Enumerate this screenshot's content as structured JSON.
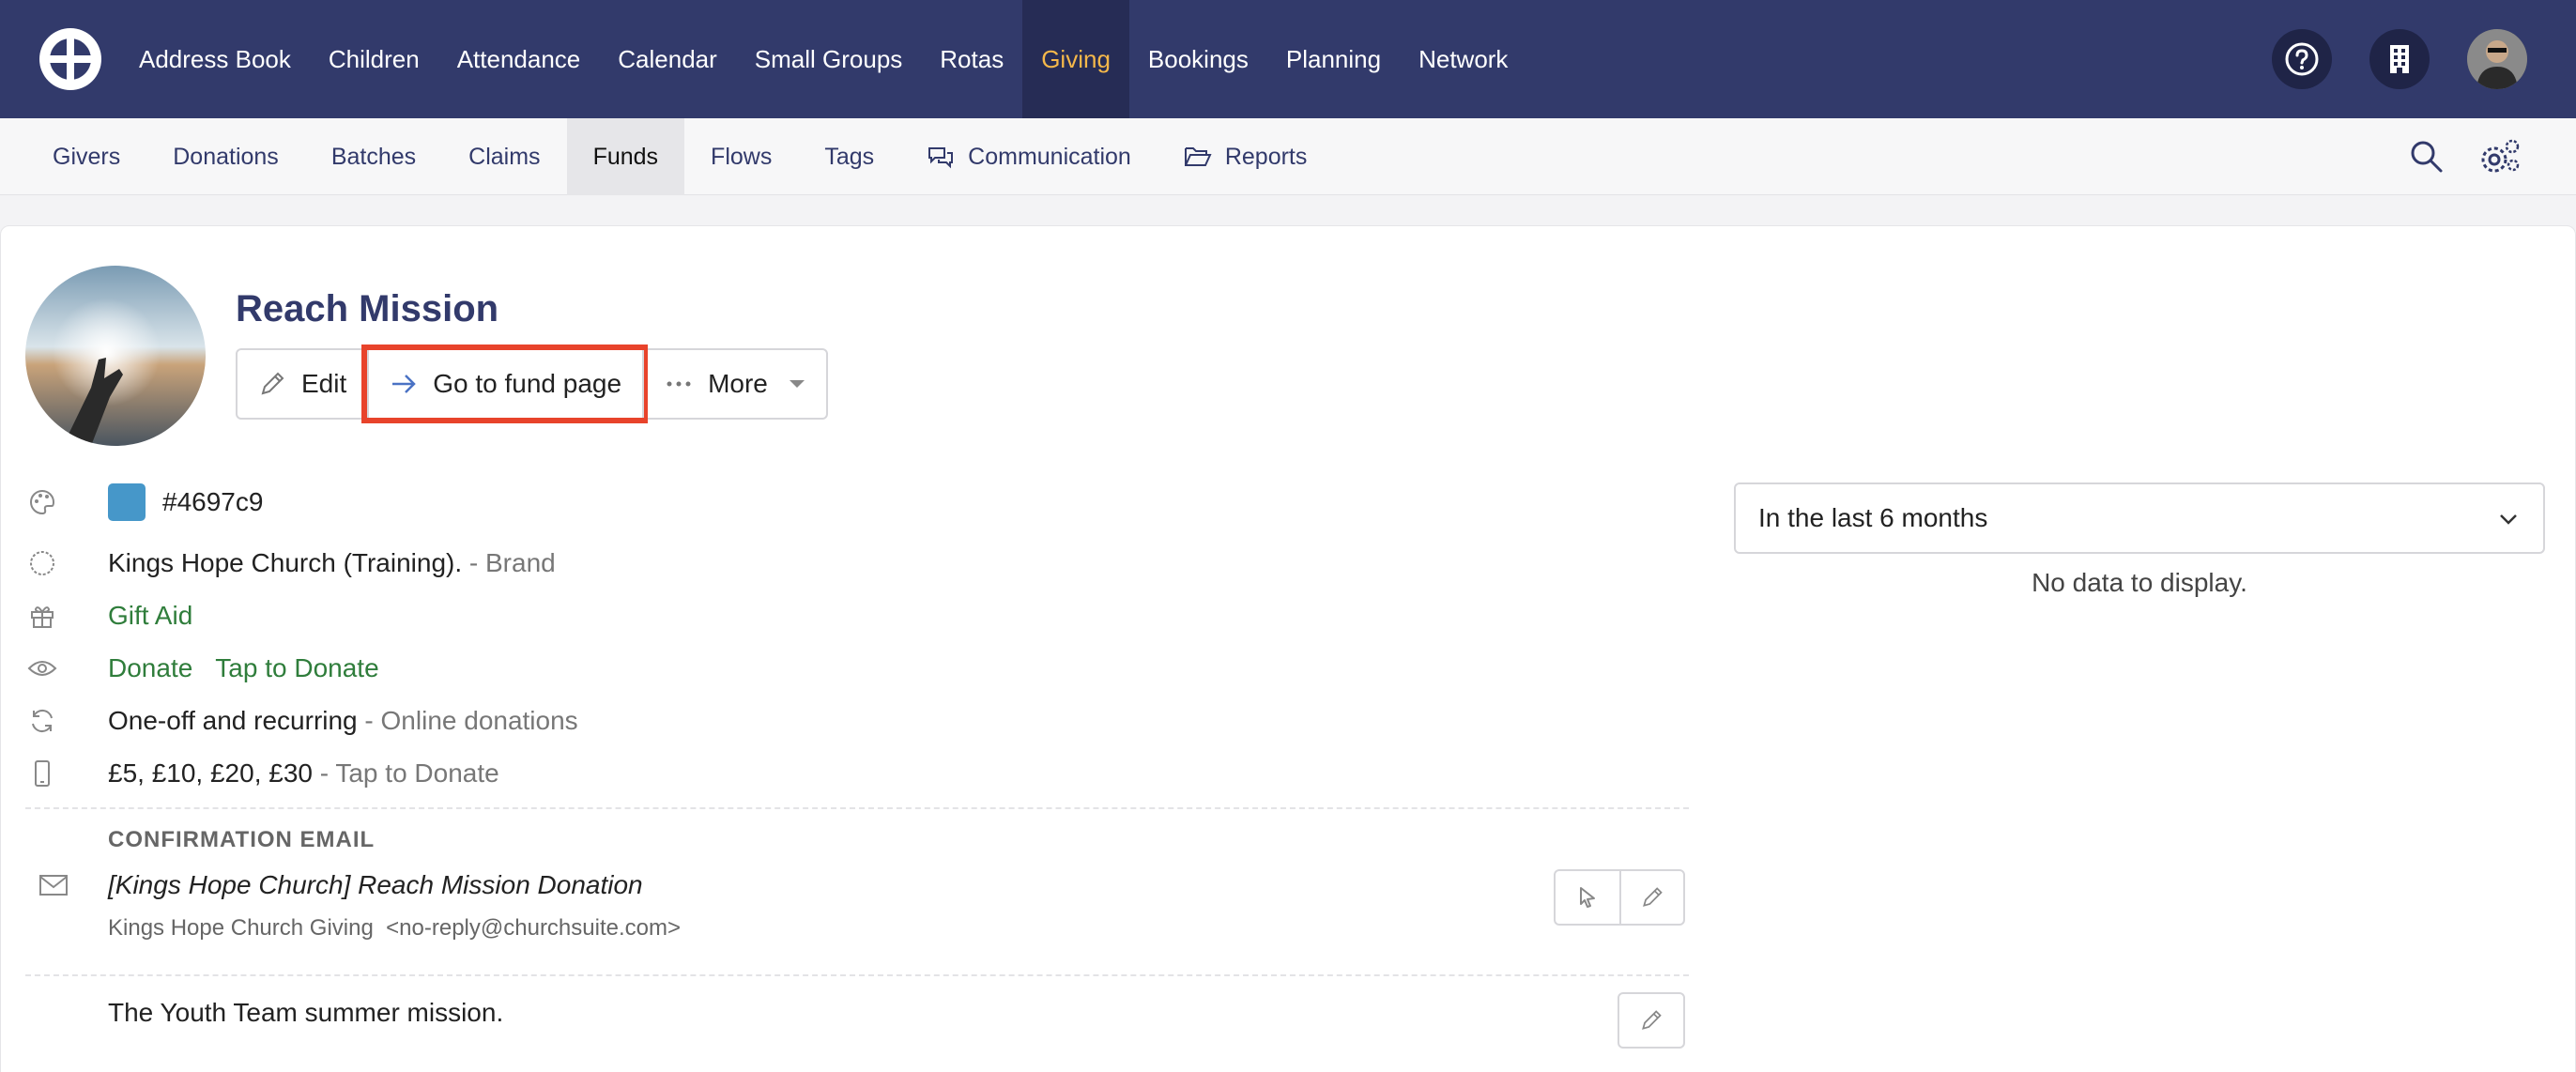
{
  "topnav": {
    "items": [
      "Address Book",
      "Children",
      "Attendance",
      "Calendar",
      "Small Groups",
      "Rotas",
      "Giving",
      "Bookings",
      "Planning",
      "Network"
    ],
    "active": "Giving",
    "right_icons": [
      "help-icon",
      "building-icon",
      "user-avatar"
    ]
  },
  "subnav": {
    "items": [
      "Givers",
      "Donations",
      "Batches",
      "Claims",
      "Funds",
      "Flows",
      "Tags",
      "Communication",
      "Reports"
    ],
    "active": "Funds"
  },
  "fund": {
    "title": "Reach Mission",
    "actions": {
      "edit": "Edit",
      "goto": "Go to fund page",
      "more": "More"
    },
    "color_hex": "#4697c9",
    "brand_name": "Kings Hope Church (Training).",
    "brand_suffix": "- Brand",
    "gift_aid": "Gift Aid",
    "visibility_donate": "Donate",
    "visibility_tap": "Tap to Donate",
    "recurring": "One-off and recurring",
    "recurring_suffix": "- Online donations",
    "amounts": "£5, £10, £20, £30",
    "amounts_suffix": "- Tap to Donate",
    "confirmation_label": "CONFIRMATION EMAIL",
    "email_subject": "[Kings Hope Church] Reach Mission Donation",
    "email_from_name": "Kings Hope Church Giving",
    "email_from_address": "<no-reply@churchsuite.com>",
    "description": "The Youth Team summer mission."
  },
  "stats": {
    "period": "In the last 6 months",
    "empty_message": "No data to display."
  },
  "colors": {
    "topnav_bg": "#323a6b",
    "active_nav_text": "#f5b84a",
    "highlight": "#e8432b",
    "green": "#2f7d3b"
  }
}
